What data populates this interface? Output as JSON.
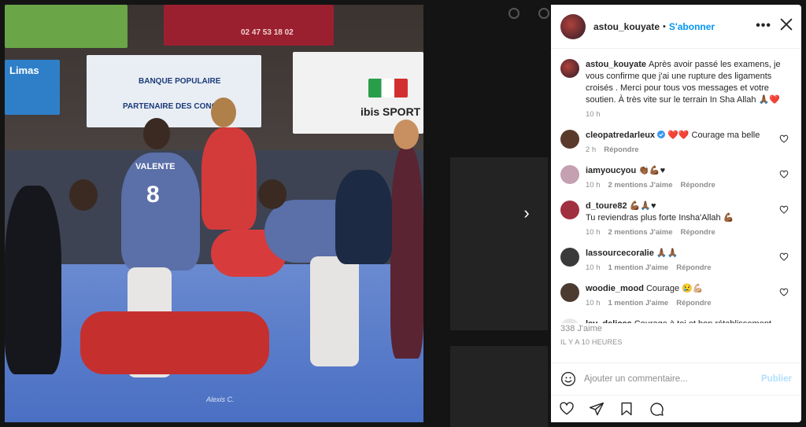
{
  "photo": {
    "ads": {
      "sponsor1": "BANQUE POPULAIRE",
      "sponsor2": "PARTENAIRE DES CONQU",
      "sponsor3": "ibis SPORT",
      "sponsor4": "Limas",
      "phone": "02 47 53 18 02"
    },
    "jersey_name": "VALENTE",
    "jersey_number": "8",
    "watermark": "Alexis C."
  },
  "header": {
    "username": "astou_kouyate",
    "dot": "•",
    "follow_label": "S'abonner",
    "more_label": "•••"
  },
  "caption": {
    "username": "astou_kouyate",
    "text": "Après avoir passé les examens, je vous confirme que j'ai une rupture des ligaments croisés . Merci pour tous vos messages et votre soutien. À très vite sur le terrain In Sha Allah 🙏🏾❤️",
    "time": "10 h"
  },
  "comments": [
    {
      "username": "cleopatredarleux",
      "verified": true,
      "text": "❤️❤️ Courage ma belle",
      "time": "2 h",
      "likes": "",
      "reply": "Répondre",
      "avatar_color": "#5a3a2a"
    },
    {
      "username": "iamyoucyou",
      "verified": false,
      "text": "👏🏾💪🏾♥",
      "time": "10 h",
      "likes": "2 mentions J'aime",
      "reply": "Répondre",
      "avatar_color": "#c4a0b0"
    },
    {
      "username": "d_toure82",
      "verified": false,
      "text": "💪🏾🙏🏾♥\nTu reviendras plus forte Insha'Allah 💪🏾",
      "time": "10 h",
      "likes": "2 mentions J'aime",
      "reply": "Répondre",
      "avatar_color": "#a03040"
    },
    {
      "username": "lassourcecoralie",
      "verified": false,
      "text": "🙏🏾🙏🏾",
      "time": "10 h",
      "likes": "1 mention J'aime",
      "reply": "Répondre",
      "avatar_color": "#3a3a3a"
    },
    {
      "username": "woodie_mood",
      "verified": false,
      "text": "Courage 😢💪🏼",
      "time": "10 h",
      "likes": "1 mention J'aime",
      "reply": "Répondre",
      "avatar_color": "#4a3a30"
    },
    {
      "username": "ley_delices",
      "verified": false,
      "text": "Courage à toi et bon rétablissement 🙆🏾",
      "time": "",
      "likes": "",
      "reply": "",
      "avatar_color": "#e8e8e8"
    }
  ],
  "stats": {
    "likes": "338 J'aime",
    "ago": "IL Y A 10 HEURES"
  },
  "add_comment": {
    "placeholder": "Ajouter un commentaire...",
    "publish_label": "Publier"
  },
  "nav": {
    "next_label": "›"
  },
  "colors": {
    "link": "#0095f6",
    "muted": "#8e8e8e",
    "publish_disabled": "#b2dffc",
    "verified": "#3897f0"
  }
}
